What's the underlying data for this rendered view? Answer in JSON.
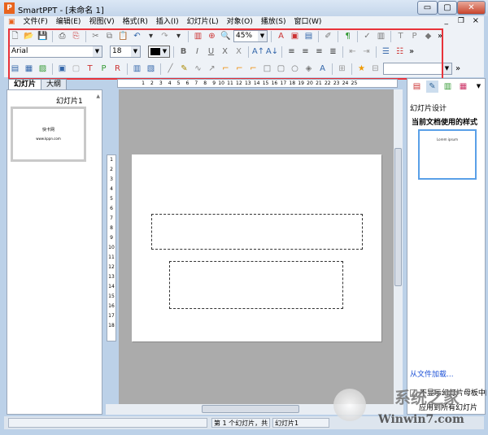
{
  "window": {
    "title": "SmartPPT - [未命名 1]",
    "app_icon": "P",
    "minimize": "▭",
    "maximize": "▢",
    "close": "✕"
  },
  "menu": [
    "文件(F)",
    "编辑(E)",
    "视图(V)",
    "格式(R)",
    "插入(I)",
    "幻灯片(L)",
    "对象(O)",
    "播放(S)",
    "窗口(W)"
  ],
  "mdi": {
    "minimize": "_",
    "restore": "❐",
    "close": "×"
  },
  "toolbar": {
    "row1": [
      "new-doc",
      "open-folder",
      "save",
      "|",
      "print",
      "pdf",
      "|",
      "cut",
      "copy",
      "paste",
      "undo",
      "dropdown",
      "redo",
      "dropdown",
      "|",
      "chart",
      "zoom-find",
      "magnifier",
      "ZOOM",
      "|",
      "text-a",
      "insert-image",
      "layout",
      "|",
      "format-brush",
      "|",
      "paragraph",
      "|",
      "spell-check",
      "columns",
      "|",
      "text-box",
      "p-box",
      "box-3d",
      "more"
    ],
    "zoom": "45%",
    "font": "Arial",
    "size": "18",
    "row2_after": [
      "|",
      "bold",
      "italic",
      "underline",
      "strike",
      "shadow",
      "|",
      "grow-font",
      "shrink-font",
      "|",
      "align-left",
      "align-center",
      "align-right",
      "justify",
      "|",
      "indent-left",
      "indent-right",
      "|",
      "bullets",
      "numbering",
      "more"
    ],
    "row3": [
      "textbox-frame",
      "table",
      "picture",
      "|",
      "ole",
      "picture-frame",
      "t-frame",
      "p-frame",
      "r-frame",
      "|",
      "frame-a",
      "frame-b",
      "|",
      "line",
      "pen",
      "curve",
      "arrow",
      "connector-1",
      "connector-2",
      "connector-3",
      "rectangle",
      "rounded-rect",
      "ellipse",
      "shapes",
      "wordart",
      "|",
      "group",
      "|",
      "star",
      "ungroup",
      "COMBO",
      "more"
    ]
  },
  "left_tabs": [
    "幻灯片",
    "大纲"
  ],
  "slides": [
    {
      "label": "幻灯片1",
      "title": "快卡网",
      "subtitle": "www.kppn.com"
    }
  ],
  "ruler_h": [
    "1",
    "2",
    "3",
    "4",
    "5",
    "6",
    "7",
    "8",
    "9",
    "10",
    "11",
    "12",
    "13",
    "14",
    "15",
    "16",
    "17",
    "18",
    "19",
    "20",
    "21",
    "22",
    "23",
    "24",
    "25"
  ],
  "ruler_v": [
    "1",
    "2",
    "3",
    "4",
    "5",
    "6",
    "7",
    "8",
    "9",
    "10",
    "11",
    "12",
    "13",
    "14",
    "15",
    "16",
    "17",
    "18"
  ],
  "right_panel": {
    "section": "幻灯片设计",
    "current_style": "当前文档使用的样式",
    "template_title": "Lorem ipsum",
    "load_link": "从文件加载...",
    "checkbox_label": "不显示幻灯片母板中的",
    "apply_all": "应用到所有幻灯片"
  },
  "status": {
    "slide_pos": "第 1 个幻灯片，共",
    "slide_name": "幻灯片1"
  },
  "watermark": {
    "text": "Winwin7.com",
    "brand": "系统之家"
  },
  "colors": {
    "accent": "#e8333a",
    "canvas": "#ababab",
    "link": "#1a4fd6"
  }
}
